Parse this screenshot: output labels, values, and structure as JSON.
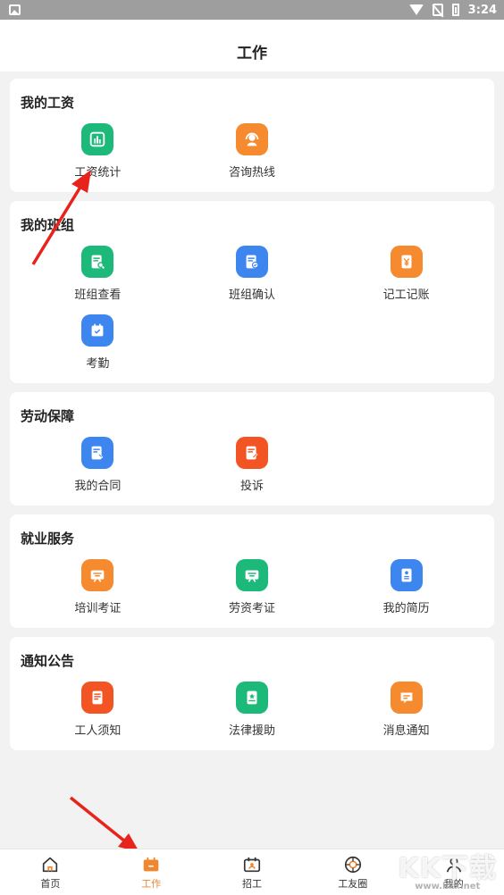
{
  "status_bar": {
    "time": "3:24"
  },
  "header": {
    "title": "工作"
  },
  "sections": [
    {
      "title": "我的工资",
      "items": [
        {
          "label": "工资统计",
          "icon": "bar-chart-icon",
          "color": "#1db97a"
        },
        {
          "label": "咨询热线",
          "icon": "headset-icon",
          "color": "#f58a2f"
        }
      ]
    },
    {
      "title": "我的班组",
      "items": [
        {
          "label": "班组查看",
          "icon": "doc-search-icon",
          "color": "#1db97a"
        },
        {
          "label": "班组确认",
          "icon": "doc-check-icon",
          "color": "#3d86f0"
        },
        {
          "label": "记工记账",
          "icon": "yen-icon",
          "color": "#f58a2f"
        },
        {
          "label": "考勤",
          "icon": "calendar-check-icon",
          "color": "#3d86f0"
        }
      ]
    },
    {
      "title": "劳动保障",
      "items": [
        {
          "label": "我的合同",
          "icon": "contract-icon",
          "color": "#3d86f0"
        },
        {
          "label": "投诉",
          "icon": "complaint-icon",
          "color": "#f25523"
        }
      ]
    },
    {
      "title": "就业服务",
      "items": [
        {
          "label": "培训考证",
          "icon": "training-icon",
          "color": "#f58a2f"
        },
        {
          "label": "劳资考证",
          "icon": "board-icon",
          "color": "#1db97a"
        },
        {
          "label": "我的简历",
          "icon": "resume-icon",
          "color": "#3d86f0"
        }
      ]
    },
    {
      "title": "通知公告",
      "items": [
        {
          "label": "工人须知",
          "icon": "notice-doc-icon",
          "color": "#f25523"
        },
        {
          "label": "法律援助",
          "icon": "law-book-icon",
          "color": "#1db97a"
        },
        {
          "label": "消息通知",
          "icon": "message-icon",
          "color": "#f58a2f"
        }
      ]
    }
  ],
  "tabbar": [
    {
      "label": "首页",
      "icon": "home-icon",
      "active": false
    },
    {
      "label": "工作",
      "icon": "work-icon",
      "active": true
    },
    {
      "label": "招工",
      "icon": "recruit-icon",
      "active": false
    },
    {
      "label": "工友圈",
      "icon": "circle-icon",
      "active": false
    },
    {
      "label": "我的",
      "icon": "profile-icon",
      "active": false
    }
  ],
  "watermark": {
    "text": "KK下载",
    "url": "www.kkx.net"
  },
  "colors": {
    "accent": "#f0862e",
    "arrow": "#e8231c"
  }
}
